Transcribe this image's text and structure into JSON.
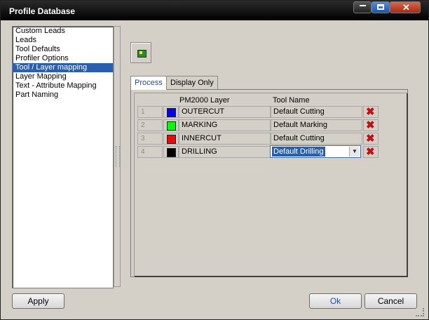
{
  "window": {
    "title": "Profile Database"
  },
  "sidebar": {
    "items": [
      {
        "label": "Custom Leads"
      },
      {
        "label": "Leads"
      },
      {
        "label": "Tool Defaults"
      },
      {
        "label": "Profiler Options"
      },
      {
        "label": "Tool / Layer mapping",
        "selected": true
      },
      {
        "label": "Layer Mapping"
      },
      {
        "label": "Text - Attribute Mapping"
      },
      {
        "label": "Part Naming"
      }
    ]
  },
  "toolbar": {
    "add_icon": "add-layer-icon"
  },
  "tabs": [
    {
      "label": "Process",
      "active": true
    },
    {
      "label": "Display Only"
    }
  ],
  "grid": {
    "headers": {
      "layer": "PM2000 Layer",
      "tool": "Tool Name"
    },
    "rows": [
      {
        "num": "1",
        "color": "#0000ff",
        "layer": "OUTERCUT",
        "tool": "Default Cutting"
      },
      {
        "num": "2",
        "color": "#00ff00",
        "layer": "MARKING",
        "tool": "Default Marking"
      },
      {
        "num": "3",
        "color": "#ff0000",
        "layer": "INNERCUT",
        "tool": "Default Cutting"
      },
      {
        "num": "4",
        "color": "#000000",
        "layer": "DRILLING",
        "tool": "Default Drilling",
        "editing": true
      }
    ]
  },
  "buttons": {
    "apply": "Apply",
    "ok": "Ok",
    "cancel": "Cancel"
  }
}
